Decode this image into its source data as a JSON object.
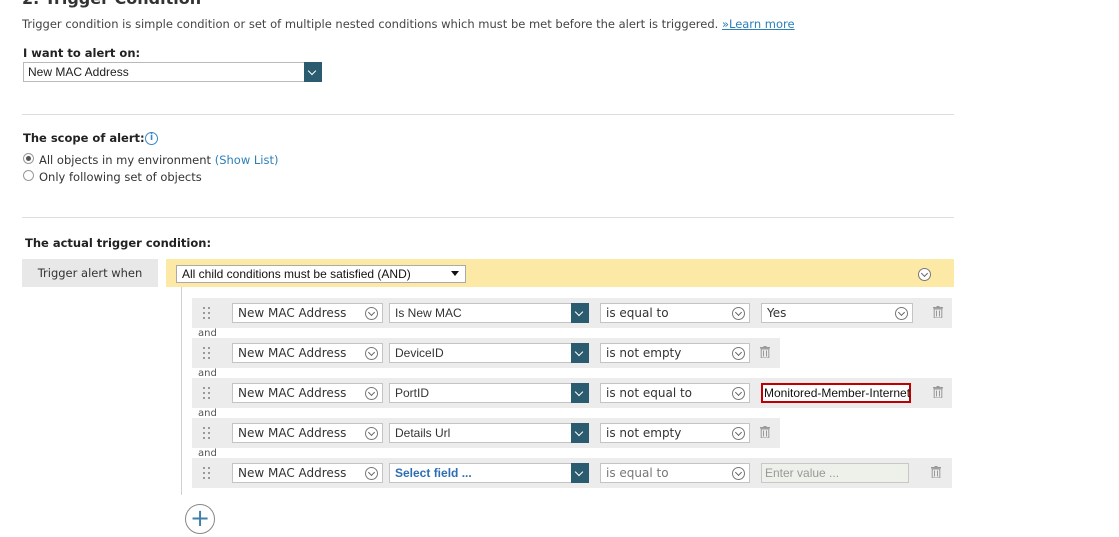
{
  "section_title": "2. Trigger Condition",
  "description": {
    "text": "Trigger condition is simple condition or set of multiple nested conditions which must be met before the alert is triggered. ",
    "link_prefix": "»",
    "link_label": "Learn more"
  },
  "alert_on": {
    "label": "I want to alert on:",
    "value": "New MAC Address"
  },
  "scope": {
    "label": "The scope of alert:",
    "options": [
      {
        "label": "All objects in my environment ",
        "link": "(Show List)",
        "checked": true
      },
      {
        "label": "Only following set of objects",
        "checked": false
      }
    ]
  },
  "trigger": {
    "label": "The actual trigger condition:",
    "when_label": "Trigger alert when",
    "logic_value": "All child conditions must be satisfied (AND)",
    "join_word": "and",
    "rows": [
      {
        "object": "New MAC Address",
        "field": "Is New MAC",
        "operator": "is equal to",
        "value": "Yes",
        "value_type": "select"
      },
      {
        "object": "New MAC Address",
        "field": "DeviceID",
        "operator": "is not empty",
        "value": "",
        "value_type": "none"
      },
      {
        "object": "New MAC Address",
        "field": "PortID",
        "operator": "is not equal to",
        "value": "Monitored-Member-Internet",
        "value_type": "input-error"
      },
      {
        "object": "New MAC Address",
        "field": "Details Url",
        "operator": "is not empty",
        "value": "",
        "value_type": "none"
      },
      {
        "object": "New MAC Address",
        "field": "Select field ...",
        "operator": "is equal to",
        "value_placeholder": "Enter value ...",
        "value_type": "input-disabled"
      }
    ]
  },
  "add_condition_icon": "plus-icon",
  "colors": {
    "accent_dark": "#2a5b6e",
    "trigger_bar": "#fde9a6",
    "link": "#2c7fb8",
    "error_border": "#c00000"
  }
}
